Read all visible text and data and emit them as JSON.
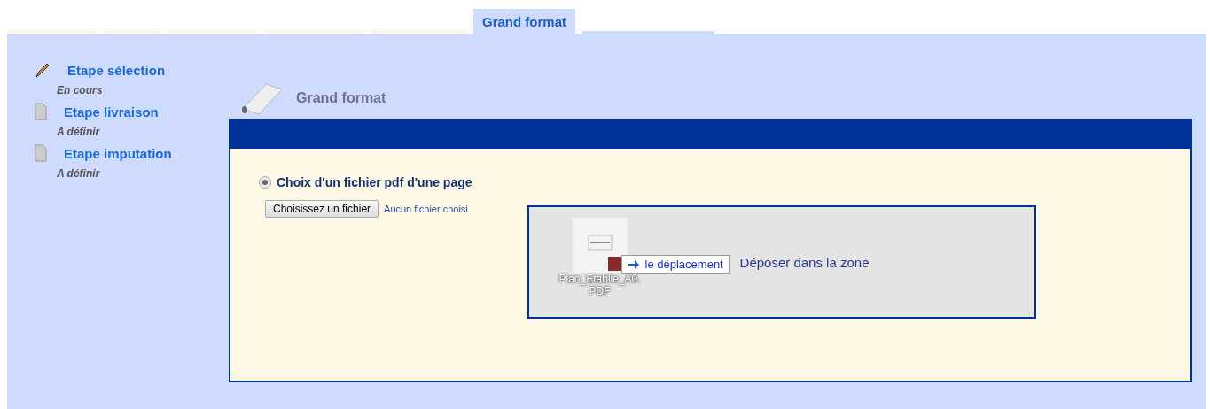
{
  "tabs": [
    {
      "selected": false
    },
    {
      "selected": false
    },
    {
      "selected": false
    },
    {
      "selected": false
    },
    {
      "selected": false
    },
    {
      "label": "Grand format",
      "selected": true
    }
  ],
  "steps": [
    {
      "kind": "pencil",
      "title": "Etape sélection",
      "status": "En cours"
    },
    {
      "kind": "document",
      "title": "Etape livraison",
      "status": "A définir"
    },
    {
      "kind": "document",
      "title": "Etape imputation",
      "status": "A définir"
    }
  ],
  "panel": {
    "title": "Grand format",
    "option": {
      "label": "Choix d'un fichier pdf d'une page",
      "selected": true
    },
    "file_button": "Choisissez un fichier",
    "file_status": "Aucun fichier choisi",
    "drop_zone": {
      "text": "Déposer dans la zone",
      "dragged_file": "Plan_Etablie_A0.\nPDF",
      "tooltip": "le déplacement"
    }
  }
}
